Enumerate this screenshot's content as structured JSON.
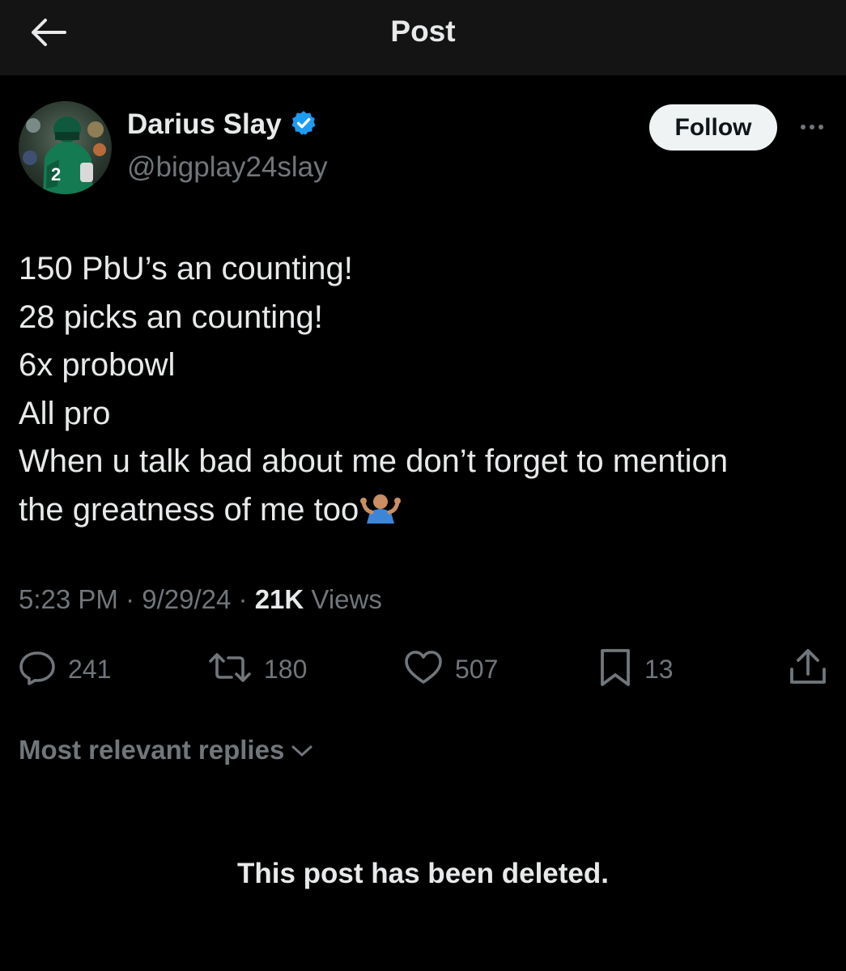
{
  "header": {
    "title": "Post",
    "back_icon": "arrow-left-icon"
  },
  "author": {
    "name": "Darius Slay",
    "handle": "@bigplay24slay",
    "verified_icon": "verified-badge-icon",
    "verified_color": "#1d9bf0",
    "follow_label": "Follow",
    "more_icon": "more-horizontal-icon"
  },
  "post": {
    "lines": [
      "150 PbU’s an counting!",
      "28 picks an counting!",
      "6x probowl",
      "All pro",
      "When u talk bad about me don’t forget to mention",
      "the greatness of me too"
    ],
    "emoji": "person-shrugging-emoji"
  },
  "meta": {
    "time": "5:23 PM",
    "separator": "·",
    "date": "9/29/24",
    "views_count": "21K",
    "views_label": "Views"
  },
  "actions": {
    "replies": {
      "icon": "reply-icon",
      "count": "241"
    },
    "reposts": {
      "icon": "repost-icon",
      "count": "180"
    },
    "likes": {
      "icon": "heart-icon",
      "count": "507"
    },
    "bookmarks": {
      "icon": "bookmark-icon",
      "count": "13"
    },
    "share": {
      "icon": "share-icon"
    }
  },
  "replies_sort": {
    "label": "Most relevant replies",
    "icon": "chevron-down-icon"
  },
  "deleted_notice": "This post has been deleted.",
  "colors": {
    "background": "#000000",
    "header_background": "#141414",
    "primary_text": "#e7e9ea",
    "secondary_text": "#71767b",
    "follow_button": "#eff3f4"
  }
}
